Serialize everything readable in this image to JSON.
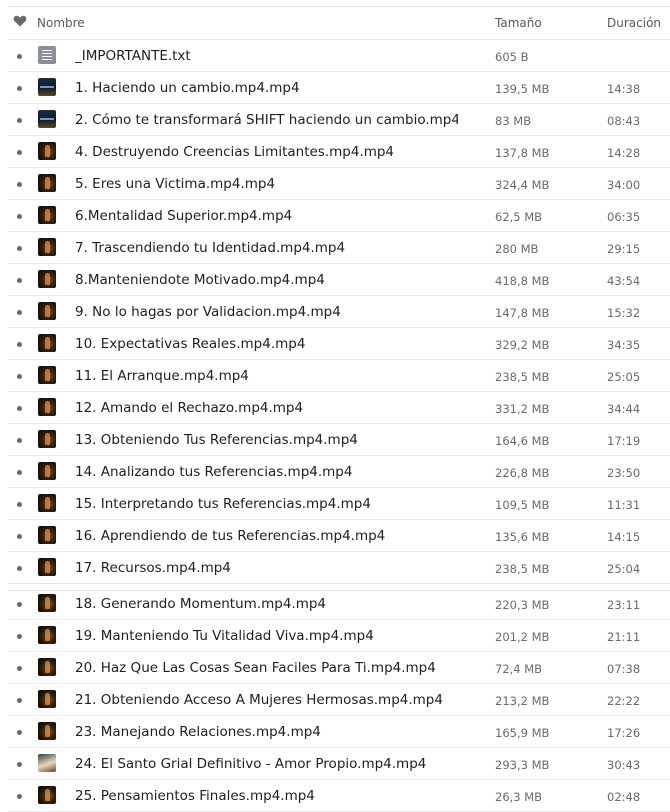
{
  "header": {
    "heart_icon": "heart-icon",
    "name_label": "Nombre",
    "size_label": "Tamaño",
    "duration_label": "Duración"
  },
  "files": [
    {
      "name": "_IMPORTANTE.txt",
      "size": "605 B",
      "duration": "",
      "thumb": "doc"
    },
    {
      "name": "1. Haciendo un cambio.mp4.mp4",
      "size": "139,5 MB",
      "duration": "14:38",
      "thumb": "blue"
    },
    {
      "name": "2. Cómo te transformará SHIFT haciendo un cambio.mp4.",
      "size": "83 MB",
      "duration": "08:43",
      "thumb": "blue"
    },
    {
      "name": "4. Destruyendo Creencias Limitantes.mp4.mp4",
      "size": "137,8 MB",
      "duration": "14:28",
      "thumb": "video"
    },
    {
      "name": "5. Eres una Victima.mp4.mp4",
      "size": "324,4 MB",
      "duration": "34:00",
      "thumb": "video"
    },
    {
      "name": "6.Mentalidad Superior.mp4.mp4",
      "size": "62,5 MB",
      "duration": "06:35",
      "thumb": "video"
    },
    {
      "name": "7. Trascendiendo tu Identidad.mp4.mp4",
      "size": "280 MB",
      "duration": "29:15",
      "thumb": "video"
    },
    {
      "name": "8.Manteniendote Motivado.mp4.mp4",
      "size": "418,8 MB",
      "duration": "43:54",
      "thumb": "video"
    },
    {
      "name": "9. No lo hagas por Validacion.mp4.mp4",
      "size": "147,8 MB",
      "duration": "15:32",
      "thumb": "video"
    },
    {
      "name": "10. Expectativas Reales.mp4.mp4",
      "size": "329,2 MB",
      "duration": "34:35",
      "thumb": "video"
    },
    {
      "name": "11. El Arranque.mp4.mp4",
      "size": "238,5 MB",
      "duration": "25:05",
      "thumb": "video"
    },
    {
      "name": "12. Amando el Rechazo.mp4.mp4",
      "size": "331,2 MB",
      "duration": "34:44",
      "thumb": "video"
    },
    {
      "name": "13. Obteniendo Tus Referencias.mp4.mp4",
      "size": "164,6 MB",
      "duration": "17:19",
      "thumb": "video"
    },
    {
      "name": "14. Analizando tus Referencias.mp4.mp4",
      "size": "226,8 MB",
      "duration": "23:50",
      "thumb": "video"
    },
    {
      "name": "15. Interpretando tus Referencias.mp4.mp4",
      "size": "109,5 MB",
      "duration": "11:31",
      "thumb": "video"
    },
    {
      "name": "16. Aprendiendo de tus Referencias.mp4.mp4",
      "size": "135,6 MB",
      "duration": "14:15",
      "thumb": "video"
    },
    {
      "name": "17. Recursos.mp4.mp4",
      "size": "238,5 MB",
      "duration": "25:04",
      "thumb": "video"
    },
    {
      "name": "18. Generando Momentum.mp4.mp4",
      "size": "220,3 MB",
      "duration": "23:11",
      "thumb": "video"
    },
    {
      "name": "19. Manteniendo Tu Vitalidad Viva.mp4.mp4",
      "size": "201,2 MB",
      "duration": "21:11",
      "thumb": "video"
    },
    {
      "name": "20. Haz Que Las Cosas Sean Faciles Para Ti.mp4.mp4",
      "size": "72,4 MB",
      "duration": "07:38",
      "thumb": "video"
    },
    {
      "name": "21. Obteniendo Acceso A Mujeres Hermosas.mp4.mp4",
      "size": "213,2 MB",
      "duration": "22:22",
      "thumb": "video"
    },
    {
      "name": "23. Manejando Relaciones.mp4.mp4",
      "size": "165,9 MB",
      "duration": "17:26",
      "thumb": "video"
    },
    {
      "name": "24. El Santo Grial Definitivo - Amor Propio.mp4.mp4",
      "size": "293,3 MB",
      "duration": "30:43",
      "thumb": "bright"
    },
    {
      "name": "25. Pensamientos Finales.mp4.mp4",
      "size": "26,3 MB",
      "duration": "02:48",
      "thumb": "video"
    }
  ]
}
